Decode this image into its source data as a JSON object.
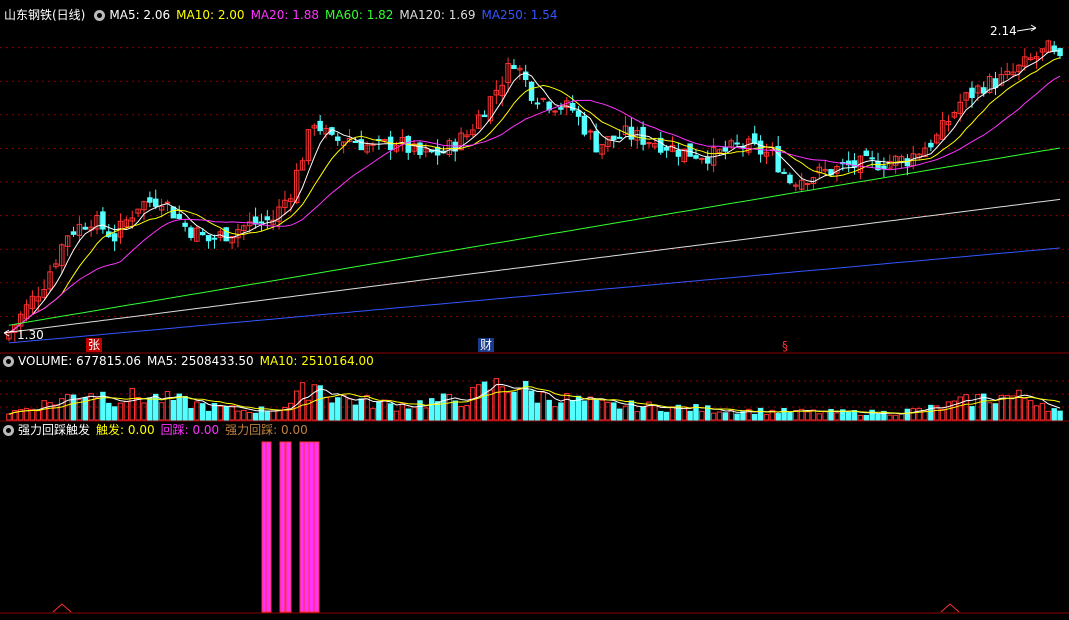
{
  "window": {
    "stock_name": "山东钢铁",
    "period": "(日线)",
    "stock_title": "山东钢铁(日线)"
  },
  "indicators": {
    "main": [
      {
        "label": "MA5: 2.06",
        "color": "#ffffff"
      },
      {
        "label": "MA10: 2.00",
        "color": "#ffff00"
      },
      {
        "label": "MA20: 1.88",
        "color": "#ff33ff"
      },
      {
        "label": "MA60: 1.82",
        "color": "#33ff33"
      },
      {
        "label": "MA120: 1.69",
        "color": "#dddddd"
      },
      {
        "label": "MA250: 1.54",
        "color": "#3355ff"
      }
    ],
    "volume": [
      {
        "label": "VOLUME: 677815.06",
        "color": "#ffffff"
      },
      {
        "label": "MA5: 2508433.50",
        "color": "#ffffff"
      },
      {
        "label": "MA10: 2510164.00",
        "color": "#ffff00"
      }
    ],
    "custom": [
      {
        "label": "强力回踩触发",
        "color": "#ffffff"
      },
      {
        "label": "触发: 0.00",
        "color": "#ffff00"
      },
      {
        "label": "回踩: 0.00",
        "color": "#ff33ff"
      },
      {
        "label": "强力回踩: 0.00",
        "color": "#c08040"
      }
    ]
  },
  "markers": {
    "high_label": "2.14",
    "low_label": "1.30",
    "event_zhang": "张",
    "event_cai": "财",
    "event_third": "§"
  },
  "colors": {
    "up": "#ff3232",
    "down": "#54ffff",
    "grid": "#8b0000",
    "ma5": "#ffffff",
    "ma10": "#ffff00",
    "ma20": "#ff33ff",
    "ma60": "#33ff33",
    "ma120": "#dddddd",
    "ma250": "#3355ff",
    "signal_bar": "#ff33ff",
    "signal_outline": "#ff3232"
  },
  "chart_data": {
    "type": "candlestick",
    "y_range": [
      1.25,
      2.2
    ],
    "high": 2.14,
    "low": 1.3,
    "series": {
      "close_anchors": [
        [
          0,
          1.3
        ],
        [
          6,
          1.44
        ],
        [
          10,
          1.58
        ],
        [
          14,
          1.62
        ],
        [
          18,
          1.57
        ],
        [
          22,
          1.66
        ],
        [
          26,
          1.68
        ],
        [
          30,
          1.6
        ],
        [
          34,
          1.56
        ],
        [
          40,
          1.6
        ],
        [
          45,
          1.62
        ],
        [
          48,
          1.7
        ],
        [
          52,
          1.9
        ],
        [
          55,
          1.84
        ],
        [
          58,
          1.85
        ],
        [
          62,
          1.82
        ],
        [
          66,
          1.84
        ],
        [
          70,
          1.8
        ],
        [
          74,
          1.81
        ],
        [
          78,
          1.86
        ],
        [
          82,
          1.96
        ],
        [
          86,
          2.07
        ],
        [
          89,
          1.98
        ],
        [
          92,
          1.95
        ],
        [
          96,
          1.93
        ],
        [
          100,
          1.83
        ],
        [
          105,
          1.86
        ],
        [
          110,
          1.84
        ],
        [
          115,
          1.81
        ],
        [
          120,
          1.8
        ],
        [
          125,
          1.83
        ],
        [
          130,
          1.8
        ],
        [
          133,
          1.73
        ],
        [
          138,
          1.75
        ],
        [
          143,
          1.77
        ],
        [
          148,
          1.78
        ],
        [
          153,
          1.79
        ],
        [
          158,
          1.85
        ],
        [
          162,
          1.95
        ],
        [
          166,
          2.0
        ],
        [
          170,
          2.02
        ],
        [
          174,
          2.07
        ],
        [
          177,
          2.1
        ],
        [
          179,
          2.06
        ]
      ],
      "volume_anchors": [
        [
          0,
          0.15
        ],
        [
          8,
          0.4
        ],
        [
          14,
          0.62
        ],
        [
          18,
          0.45
        ],
        [
          22,
          0.5
        ],
        [
          28,
          0.42
        ],
        [
          34,
          0.28
        ],
        [
          40,
          0.2
        ],
        [
          45,
          0.22
        ],
        [
          48,
          0.35
        ],
        [
          52,
          0.8
        ],
        [
          55,
          0.5
        ],
        [
          60,
          0.4
        ],
        [
          66,
          0.3
        ],
        [
          72,
          0.38
        ],
        [
          78,
          0.45
        ],
        [
          82,
          0.7
        ],
        [
          86,
          0.75
        ],
        [
          90,
          0.5
        ],
        [
          96,
          0.42
        ],
        [
          102,
          0.3
        ],
        [
          110,
          0.28
        ],
        [
          120,
          0.22
        ],
        [
          130,
          0.18
        ],
        [
          140,
          0.16
        ],
        [
          150,
          0.15
        ],
        [
          158,
          0.25
        ],
        [
          165,
          0.45
        ],
        [
          170,
          0.5
        ],
        [
          175,
          0.45
        ],
        [
          179,
          0.15
        ]
      ],
      "signal_bars": [
        262,
        266,
        280,
        286,
        300,
        304,
        309,
        314
      ]
    }
  }
}
